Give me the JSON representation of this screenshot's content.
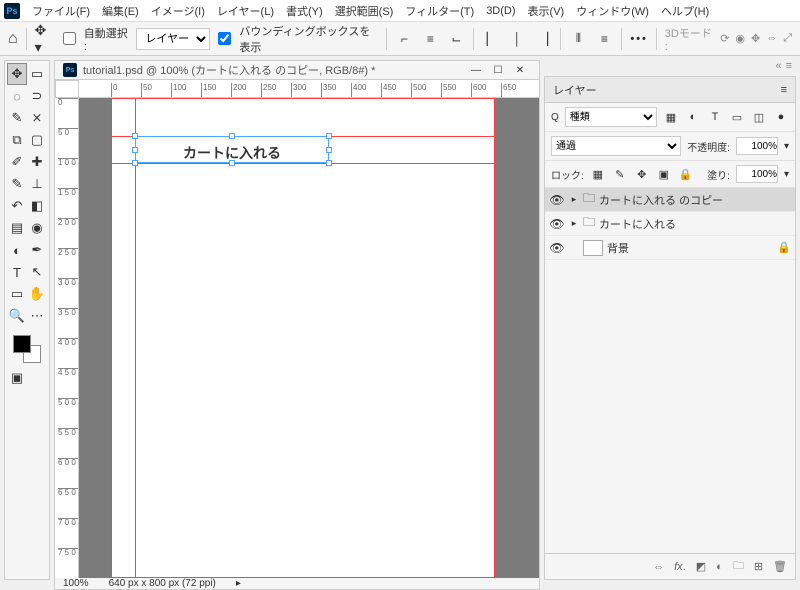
{
  "menubar": {
    "items": [
      "ファイル(F)",
      "編集(E)",
      "イメージ(I)",
      "レイヤー(L)",
      "書式(Y)",
      "選択範囲(S)",
      "フィルター(T)",
      "3D(D)",
      "表示(V)",
      "ウィンドウ(W)",
      "ヘルプ(H)"
    ]
  },
  "options": {
    "auto_select_label": "自動選択 :",
    "auto_select_value": "レイヤー",
    "show_bbox_label": "バウンディングボックスを 表示",
    "threed_mode": "3Dモード :"
  },
  "document": {
    "title": "tutorial1.psd @ 100% (カートに入れる のコピー, RGB/8#) *",
    "canvas_text": "カートに入れる",
    "ruler_h_ticks": [
      0,
      50,
      100,
      150,
      200,
      250,
      300,
      350,
      400,
      450,
      500,
      550,
      600,
      650
    ],
    "ruler_v_ticks": [
      0,
      50,
      100,
      150,
      200,
      250,
      300,
      350,
      400,
      450,
      500,
      550,
      600,
      650,
      700,
      750
    ],
    "zoom": "100%",
    "dims": "640 px x 800 px (72 ppi)"
  },
  "layers_panel": {
    "title": "レイヤー",
    "kind_label": "種類",
    "search_icon": "Q",
    "blend_mode": "通過",
    "opacity_label": "不透明度:",
    "opacity_value": "100%",
    "lock_label": "ロック:",
    "fill_label": "塗り:",
    "fill_value": "100%",
    "layers": [
      {
        "type": "group",
        "name": "カートに入れる のコピー",
        "selected": true,
        "visible": true
      },
      {
        "type": "group",
        "name": "カートに入れる",
        "selected": false,
        "visible": true
      },
      {
        "type": "layer",
        "name": "背景",
        "selected": false,
        "visible": true,
        "locked": true
      }
    ]
  }
}
